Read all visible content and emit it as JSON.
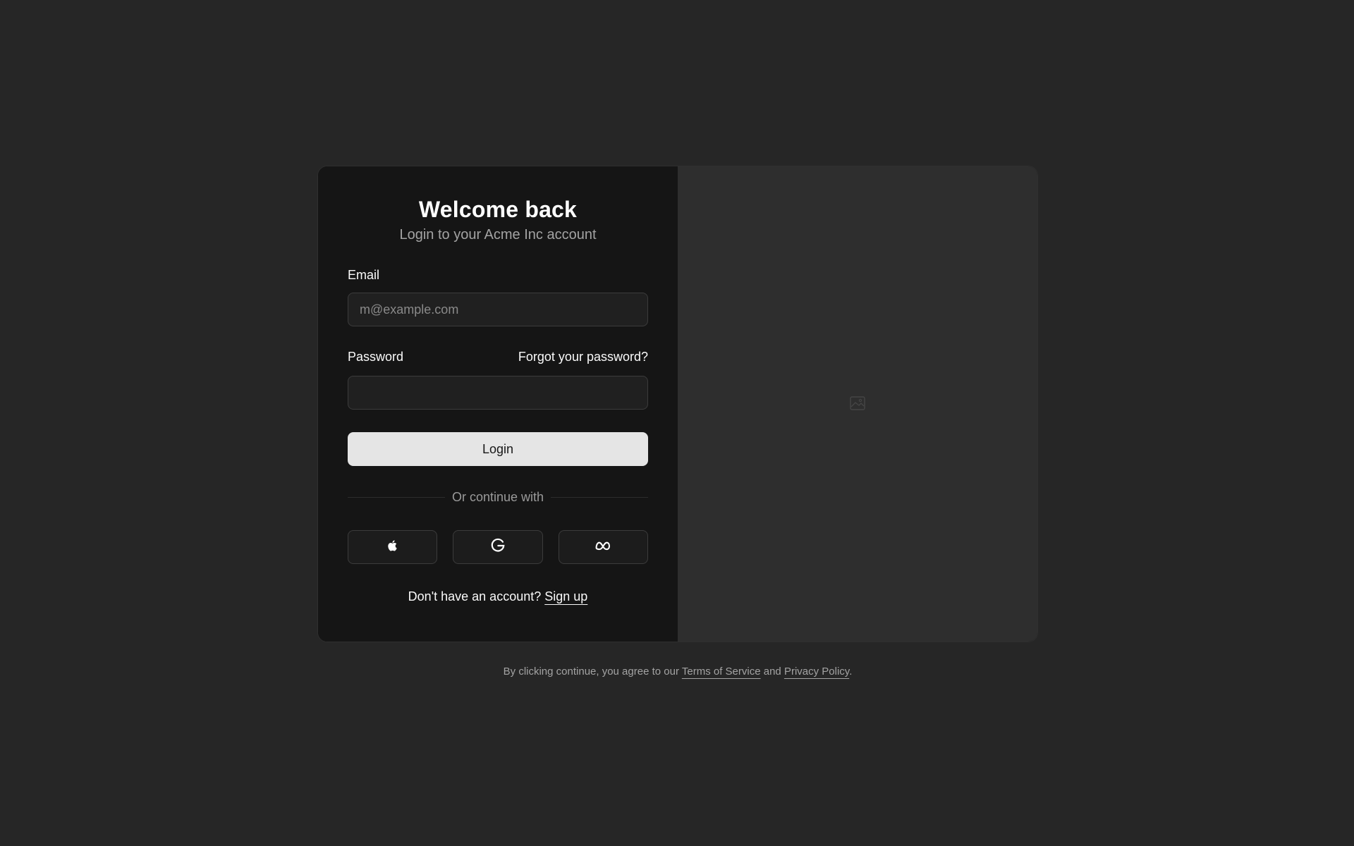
{
  "login_form": {
    "title": "Welcome back",
    "subtitle": "Login to your Acme Inc account",
    "email": {
      "label": "Email",
      "placeholder": "m@example.com",
      "value": ""
    },
    "password": {
      "label": "Password",
      "forgot_link": "Forgot your password?",
      "value": ""
    },
    "login_button": "Login",
    "divider_text": "Or continue with",
    "social_buttons": [
      {
        "provider": "Apple",
        "icon": "apple-icon"
      },
      {
        "provider": "Google",
        "icon": "google-icon"
      },
      {
        "provider": "Meta",
        "icon": "meta-icon"
      }
    ],
    "signup": {
      "prompt": "Don't have an account?",
      "link": "Sign up"
    }
  },
  "image_panel": {
    "icon": "image-placeholder-icon"
  },
  "legal": {
    "prefix": "By clicking continue, you agree to our",
    "terms_link": "Terms of Service",
    "conjunction": "and",
    "privacy_link": "Privacy Policy",
    "suffix": "."
  },
  "colors": {
    "page_background": "#262626",
    "form_background": "#151515",
    "image_background": "#2e2e2e",
    "button_background": "#e5e5e5",
    "muted_text": "#a3a3a3"
  }
}
